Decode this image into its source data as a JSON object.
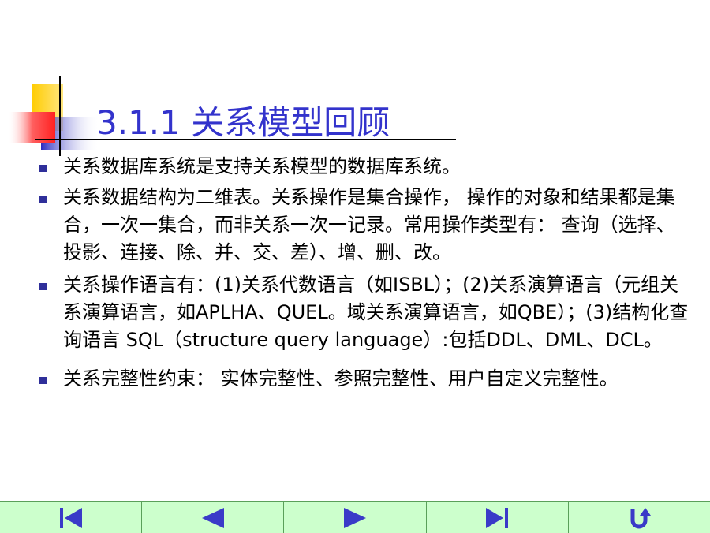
{
  "slide": {
    "title": "3.1.1 关系模型回顾",
    "bullets": [
      {
        "text": "关系数据库系统是支持关系模型的数据库系统。"
      },
      {
        "text": "关系数据结构为二维表。关系操作是集合操作， 操作的对象和结果都是集合，一次一集合，而非关系一次一记录。常用操作类型有： 查询（选择、投影、连接、除、并、交、差）、增、删、改。"
      },
      {
        "text": "关系操作语言有：(1)关系代数语言（如ISBL）；(2)关系演算语言（元组关系演算语言，如APLHA、QUEL。域关系演算语言，如QBE）；(3)结构化查询语言 SQL（structure query language）:包括DDL、DML、DCL。"
      },
      {
        "text": "关系完整性约束： 实体完整性、参照完整性、用户自定义完整性。"
      }
    ]
  },
  "colors": {
    "title": "#3333cc",
    "bullet_marker": "#2f2f9a",
    "nav_background": "#ccffcc",
    "nav_icon": "#3a3ac8",
    "decor_yellow": "#ffcc00",
    "decor_blue": "#3333cc",
    "decor_red": "#ff4040"
  },
  "nav": {
    "buttons": [
      {
        "icon": "first-slide-icon"
      },
      {
        "icon": "previous-slide-icon"
      },
      {
        "icon": "next-slide-icon"
      },
      {
        "icon": "last-slide-icon"
      },
      {
        "icon": "return-icon"
      }
    ]
  }
}
